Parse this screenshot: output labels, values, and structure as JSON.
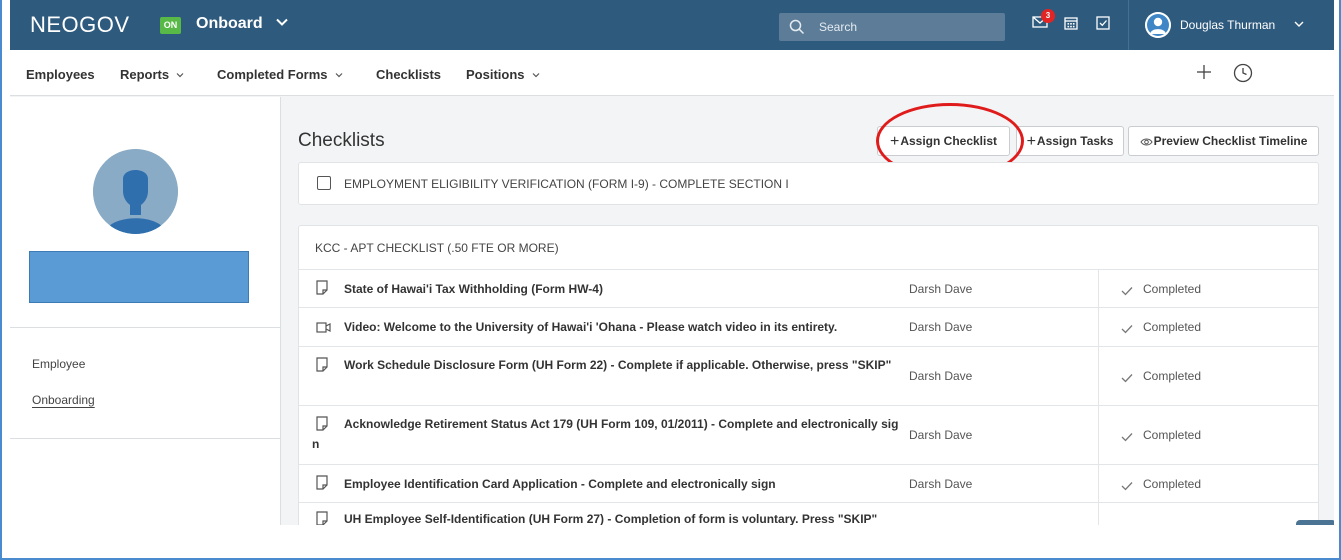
{
  "topbar": {
    "brand": "NEOGOV",
    "badge": "ON",
    "app_name": "Onboard",
    "search_placeholder": "Search",
    "notification_count": "3",
    "user_name": "Douglas Thurman"
  },
  "nav": {
    "items": [
      "Employees",
      "Reports",
      "Completed Forms",
      "Checklists",
      "Positions"
    ]
  },
  "left_panel": {
    "links": [
      "Employee",
      "Onboarding"
    ]
  },
  "main": {
    "title": "Checklists",
    "buttons": {
      "assign_checklist": "Assign Checklist",
      "assign_tasks": "Assign Tasks",
      "preview_timeline": "Preview Checklist Timeline"
    },
    "standalone_item": "EMPLOYMENT ELIGIBILITY VERIFICATION (FORM I-9) - COMPLETE SECTION I",
    "checklist_name": "KCC - APT CHECKLIST (.50 FTE OR MORE)",
    "rows": [
      {
        "icon": "document-icon",
        "title": "State of Hawai'i Tax Withholding (Form HW-4)",
        "assignee": "Darsh Dave",
        "status": "Completed"
      },
      {
        "icon": "video-icon",
        "title": "Video: Welcome to the University of Hawai'i 'Ohana - Please watch video in its entirety.",
        "assignee": "Darsh Dave",
        "status": "Completed"
      },
      {
        "icon": "document-icon",
        "title": "Work Schedule Disclosure Form (UH Form 22) - Complete if applicable. Otherwise, press \"SKIP\"",
        "assignee": "Darsh Dave",
        "status": "Completed"
      },
      {
        "icon": "document-icon",
        "title": "Acknowledge Retirement Status Act 179 (UH Form 109, 01/2011) - Complete and electronically sign",
        "assignee": "Darsh Dave",
        "status": "Completed"
      },
      {
        "icon": "document-icon",
        "title": "Employee Identification Card Application - Complete and electronically sign",
        "assignee": "Darsh Dave",
        "status": "Completed"
      },
      {
        "icon": "document-icon",
        "title": "UH Employee Self-Identification (UH Form 27) - Completion of form is voluntary. Press \"SKIP\"",
        "assignee": "",
        "status": ""
      }
    ]
  },
  "colors": {
    "topbar": "#2e5a7e",
    "on_badge": "#58b947",
    "notification": "#e32424",
    "highlight_ring": "#e01b1b",
    "redaction": "#5b9bd5"
  }
}
